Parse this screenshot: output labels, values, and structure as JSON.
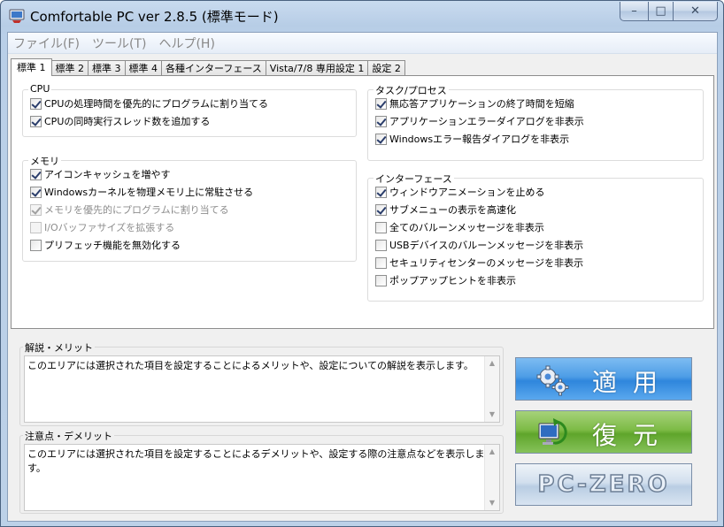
{
  "window": {
    "title": "Comfortable PC ver 2.8.5 (標準モード)",
    "caption": {
      "minimize": "–",
      "maximize": "□",
      "close": "✕"
    }
  },
  "menu": [
    "ファイル(F)",
    "ツール(T)",
    "ヘルプ(H)"
  ],
  "tabs": [
    {
      "label": "標準 1",
      "active": true
    },
    {
      "label": "標準 2",
      "active": false
    },
    {
      "label": "標準 3",
      "active": false
    },
    {
      "label": "標準 4",
      "active": false
    },
    {
      "label": "各種インターフェース",
      "active": false
    },
    {
      "label": "Vista/7/8 専用設定 1",
      "active": false
    },
    {
      "label": "設定 2",
      "active": false
    }
  ],
  "groups": {
    "cpu": {
      "title": "CPU",
      "options": [
        {
          "label": "CPUの処理時間を優先的にプログラムに割り当てる",
          "checked": true,
          "enabled": true
        },
        {
          "label": "CPUの同時実行スレッド数を追加する",
          "checked": true,
          "enabled": true
        }
      ]
    },
    "memory": {
      "title": "メモリ",
      "options": [
        {
          "label": "アイコンキャッシュを増やす",
          "checked": true,
          "enabled": true
        },
        {
          "label": "Windowsカーネルを物理メモリ上に常駐させる",
          "checked": true,
          "enabled": true
        },
        {
          "label": "メモリを優先的にプログラムに割り当てる",
          "checked": true,
          "enabled": false
        },
        {
          "label": "I/Oバッファサイズを拡張する",
          "checked": false,
          "enabled": false
        },
        {
          "label": "プリフェッチ機能を無効化する",
          "checked": false,
          "enabled": true
        }
      ]
    },
    "task": {
      "title": "タスク/プロセス",
      "options": [
        {
          "label": "無応答アプリケーションの終了時間を短縮",
          "checked": true,
          "enabled": true
        },
        {
          "label": "アプリケーションエラーダイアログを非表示",
          "checked": true,
          "enabled": true
        },
        {
          "label": "Windowsエラー報告ダイアログを非表示",
          "checked": true,
          "enabled": true
        }
      ]
    },
    "interface": {
      "title": "インターフェース",
      "options": [
        {
          "label": "ウィンドウアニメーションを止める",
          "checked": true,
          "enabled": true
        },
        {
          "label": "サブメニューの表示を高速化",
          "checked": true,
          "enabled": true
        },
        {
          "label": "全てのバルーンメッセージを非表示",
          "checked": false,
          "enabled": true
        },
        {
          "label": "USBデバイスのバルーンメッセージを非表示",
          "checked": false,
          "enabled": true
        },
        {
          "label": "セキュリティセンターのメッセージを非表示",
          "checked": false,
          "enabled": true
        },
        {
          "label": "ポップアップヒントを非表示",
          "checked": false,
          "enabled": true
        }
      ]
    }
  },
  "info": {
    "merit": {
      "title": "解説・メリット",
      "text": "このエリアには選択された項目を設定することによるメリットや、設定についての解説を表示します。"
    },
    "demerit": {
      "title": "注意点・デメリット",
      "text": "このエリアには選択された項目を設定することによるデメリットや、設定する際の注意点などを表示します。"
    }
  },
  "buttons": {
    "apply": "適用",
    "restore": "復元",
    "zero": "PC-ZERO"
  },
  "colors": {
    "apply": "#3f95e2",
    "restore": "#6fb23a"
  }
}
